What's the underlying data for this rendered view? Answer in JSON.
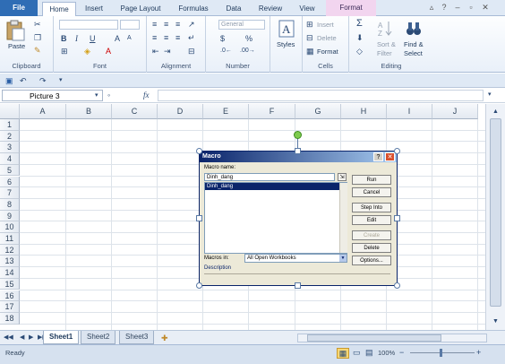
{
  "tabs": [
    "File",
    "Home",
    "Insert",
    "Page Layout",
    "Formulas",
    "Data",
    "Review",
    "View",
    "Format"
  ],
  "clipboard": {
    "paste": "Paste",
    "label": "Clipboard"
  },
  "font": {
    "label": "Font",
    "bold": "B",
    "italic": "I",
    "underline": "U"
  },
  "alignment": {
    "label": "Alignment"
  },
  "number": {
    "format": "General",
    "pct": "%",
    "label": "Number"
  },
  "styles": {
    "label": "Styles"
  },
  "cells": {
    "insert": "Insert",
    "delete": "Delete",
    "format": "Format",
    "label": "Cells"
  },
  "editing": {
    "sigma": "Σ",
    "sort": "Sort &",
    "filter": "Filter",
    "find": "Find &",
    "select": "Select",
    "label": "Editing"
  },
  "formula": {
    "namebox": "Picture 3",
    "fx": "fx"
  },
  "columns": [
    "A",
    "B",
    "C",
    "D",
    "E",
    "F",
    "G",
    "H",
    "I",
    "J"
  ],
  "rows": [
    "1",
    "2",
    "3",
    "4",
    "5",
    "6",
    "7",
    "8",
    "9",
    "10",
    "11",
    "12",
    "13",
    "14",
    "15",
    "16",
    "17",
    "18"
  ],
  "sheets": [
    "Sheet1",
    "Sheet2",
    "Sheet3"
  ],
  "status": {
    "ready": "Ready",
    "zoom": "100%",
    "minus": "−",
    "plus": "+"
  },
  "macro": {
    "title": "Macro",
    "name_label": "Macro name:",
    "name_value": "Dinh_dang",
    "list_item": "Dinh_dang",
    "buttons": [
      "Run",
      "Cancel",
      "Step Into",
      "Edit",
      "Create",
      "Delete",
      "Options..."
    ],
    "macros_in_label": "Macros in:",
    "macros_in_value": "All Open Workbooks",
    "description_label": "Description",
    "help": "?",
    "close": "✕"
  }
}
